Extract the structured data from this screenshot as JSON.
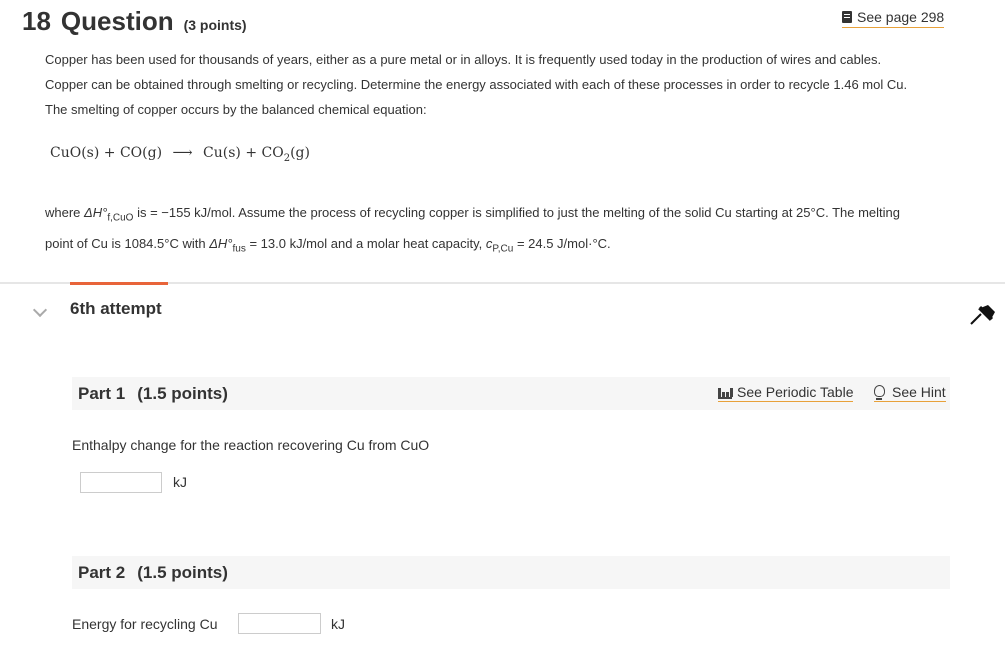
{
  "question": {
    "number": "18",
    "word": "Question",
    "points": "(3 points)",
    "see_page": "See page 298"
  },
  "intro": {
    "line1": "Copper has been used for thousands of years, either as a pure metal or in alloys. It is frequently used today in the production of wires and cables.",
    "line2": "Copper can be obtained through smelting or recycling. Determine the energy associated with each of these processes in order to recycle 1.46 mol Cu.",
    "line3": "The smelting of copper occurs by the balanced chemical equation:"
  },
  "equation": {
    "reactant1": "CuO(s)",
    "plus1": "+",
    "reactant2": "CO(g)",
    "arrow": "⟶",
    "product1": "Cu(s)",
    "plus2": "+",
    "product2_base": "CO",
    "product2_sub": "2",
    "product2_state": "(g)"
  },
  "conditions": {
    "where": "where ",
    "dh_f": "ΔH°",
    "dh_f_sub": "f,CuO",
    "dh_f_value": " is = −155 kJ/mol. Assume the process of recycling copper is simplified to just the melting of the solid Cu starting at 25°C. The melting",
    "line2_a": "point of Cu is 1084.5°C with ",
    "dh_fus": "ΔH°",
    "dh_fus_sub": "fus",
    "dh_fus_value": " = 13.0 kJ/mol and a molar heat capacity, ",
    "cp": "c",
    "cp_sub": "P,Cu",
    "cp_value": " = 24.5 J/mol·°C."
  },
  "attempt": {
    "label": "6th attempt"
  },
  "part1": {
    "label": "Part 1",
    "points": "(1.5 points)",
    "periodic_table": "See Periodic Table",
    "hint": "See Hint",
    "prompt": "Enthalpy change for the reaction recovering Cu from CuO",
    "answer_value": "",
    "unit": "kJ"
  },
  "part2": {
    "label": "Part 2",
    "points": "(1.5 points)",
    "prompt": "Energy for recycling Cu",
    "answer_value": "",
    "unit": "kJ"
  },
  "colors": {
    "accent_orange": "#e8643a",
    "link_underline": "#e8a13a",
    "text": "#333333"
  },
  "icons": {
    "see_page": "book-icon",
    "collapse": "chevron-down-icon",
    "pin": "pin-icon",
    "periodic_table": "periodic-table-icon",
    "hint": "lightbulb-icon"
  }
}
